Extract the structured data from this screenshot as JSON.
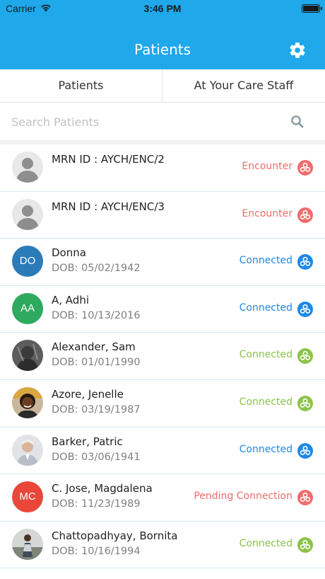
{
  "status_bar": {
    "carrier": "Carrier",
    "time": "3:46 PM"
  },
  "nav": {
    "title": "Patients"
  },
  "tabs": [
    {
      "label": "Patients"
    },
    {
      "label": "At Your Care Staff"
    }
  ],
  "search": {
    "placeholder": "Search Patients",
    "value": ""
  },
  "colors": {
    "header": "#1fa8ea",
    "encounter": "#ef6c6c",
    "connected_blue": "#1e88e5",
    "connected_green": "#8bc34a",
    "pending": "#ef6c6c"
  },
  "patients": [
    {
      "name": "MRN ID : AYCH/ENC/2",
      "dob": "",
      "status": "Encounter",
      "status_kind": "encounter",
      "avatar": "placeholder-person"
    },
    {
      "name": "MRN ID : AYCH/ENC/3",
      "dob": "",
      "status": "Encounter",
      "status_kind": "encounter",
      "avatar": "placeholder-person"
    },
    {
      "name": "Donna",
      "dob": "DOB: 05/02/1942",
      "status": "Connected",
      "status_kind": "connected-blue",
      "avatar": "initials",
      "initials": "DO",
      "avatar_color": "#2b7bb9"
    },
    {
      "name": "A, Adhi",
      "dob": "DOB: 10/13/2016",
      "status": "Connected",
      "status_kind": "connected-blue",
      "avatar": "initials",
      "initials": "AA",
      "avatar_color": "#2eaa5f"
    },
    {
      "name": "Alexander, Sam",
      "dob": "DOB: 01/01/1990",
      "status": "Connected",
      "status_kind": "connected-green",
      "avatar": "photo"
    },
    {
      "name": "Azore, Jenelle",
      "dob": "DOB: 03/19/1987",
      "status": "Connected",
      "status_kind": "connected-green",
      "avatar": "photo"
    },
    {
      "name": "Barker, Patric",
      "dob": "DOB: 03/06/1941",
      "status": "Connected",
      "status_kind": "connected-blue",
      "avatar": "photo"
    },
    {
      "name": "C. Jose, Magdalena",
      "dob": "DOB: 11/23/1989",
      "status": "Pending Connection",
      "status_kind": "pending",
      "avatar": "initials",
      "initials": "MC",
      "avatar_color": "#e8473a"
    },
    {
      "name": "Chattopadhyay, Bornita",
      "dob": "DOB: 10/16/1994",
      "status": "Connected",
      "status_kind": "connected-green",
      "avatar": "photo"
    }
  ]
}
